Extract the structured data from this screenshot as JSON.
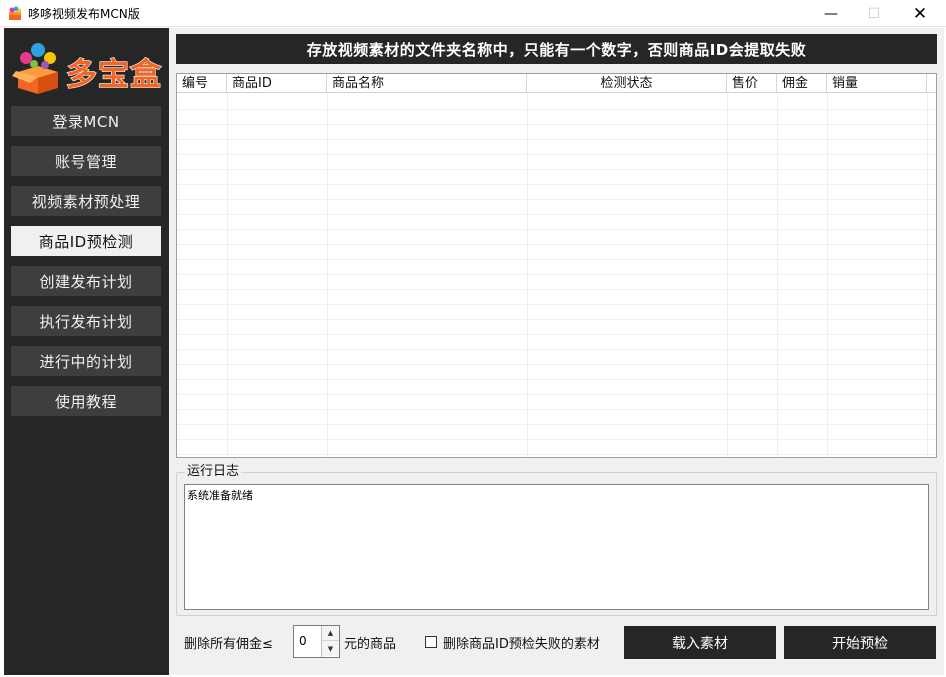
{
  "window": {
    "title": "哆哆视频发布MCN版",
    "minimize_glyph": "—",
    "maximize_glyph": "☐",
    "close_glyph": "✕"
  },
  "logo": {
    "text": "多宝盒"
  },
  "sidebar": {
    "items": [
      {
        "label": "登录MCN",
        "active": false
      },
      {
        "label": "账号管理",
        "active": false
      },
      {
        "label": "视频素材预处理",
        "active": false
      },
      {
        "label": "商品ID预检测",
        "active": true
      },
      {
        "label": "创建发布计划",
        "active": false
      },
      {
        "label": "执行发布计划",
        "active": false
      },
      {
        "label": "进行中的计划",
        "active": false
      },
      {
        "label": "使用教程",
        "active": false
      }
    ]
  },
  "main": {
    "banner": "存放视频素材的文件夹名称中，只能有一个数字，否则商品ID会提取失败",
    "table": {
      "columns": [
        "编号",
        "商品ID",
        "商品名称",
        "检测状态",
        "售价",
        "佣金",
        "销量"
      ],
      "rows": []
    },
    "log": {
      "legend": "运行日志",
      "text": "系统准备就绪"
    },
    "bottom": {
      "delete_prefix": "删除所有佣金≤",
      "threshold_value": "0",
      "delete_suffix": "元的商品",
      "checkbox_label": "删除商品ID预检失败的素材",
      "checkbox_checked": false,
      "load_button": "载入素材",
      "start_button": "开始预检"
    }
  },
  "colors": {
    "sidebar_bg": "#262626",
    "nav_bg": "#3e3e3e",
    "nav_active_bg": "#f0f0f0",
    "banner_bg": "#262626",
    "logo_orange": "#f26522"
  }
}
